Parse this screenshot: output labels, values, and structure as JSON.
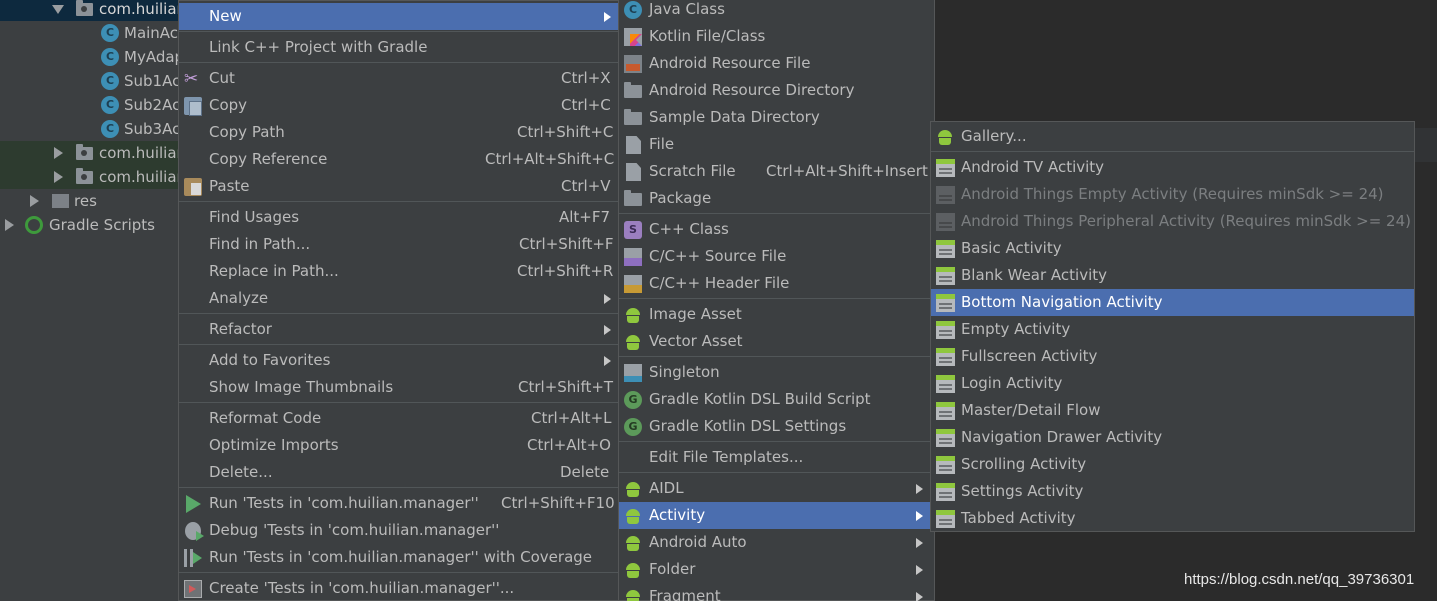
{
  "tree": {
    "items": [
      {
        "label": "com.huilian",
        "icon": "folder-icon",
        "expanded": true
      },
      {
        "label": "MainAc",
        "icon": "class-icon"
      },
      {
        "label": "MyAdap",
        "icon": "class-icon"
      },
      {
        "label": "Sub1Ac",
        "icon": "class-icon"
      },
      {
        "label": "Sub2Ac",
        "icon": "class-icon"
      },
      {
        "label": "Sub3Ac",
        "icon": "class-icon"
      },
      {
        "label": "com.huilian",
        "icon": "folder-icon",
        "expanded": false
      },
      {
        "label": "com.huilian",
        "icon": "folder-icon",
        "expanded": false
      },
      {
        "label": "res",
        "icon": "res-folder-icon",
        "expanded": false
      },
      {
        "label": "Gradle Scripts",
        "icon": "gradle-icon",
        "expanded": false
      }
    ],
    "class_glyph": "C"
  },
  "context_menu": {
    "items": [
      {
        "label": "New",
        "submenu": true
      },
      {
        "label": "Link C++ Project with Gradle"
      },
      {
        "label": "Cut",
        "shortcut": "Ctrl+X",
        "icon": "scissors-icon"
      },
      {
        "label": "Copy",
        "shortcut": "Ctrl+C",
        "icon": "copy-icon"
      },
      {
        "label": "Copy Path",
        "shortcut": "Ctrl+Shift+C"
      },
      {
        "label": "Copy Reference",
        "shortcut": "Ctrl+Alt+Shift+C"
      },
      {
        "label": "Paste",
        "shortcut": "Ctrl+V",
        "icon": "paste-icon"
      },
      {
        "label": "Find Usages",
        "shortcut": "Alt+F7"
      },
      {
        "label": "Find in Path...",
        "shortcut": "Ctrl+Shift+F"
      },
      {
        "label": "Replace in Path...",
        "shortcut": "Ctrl+Shift+R"
      },
      {
        "label": "Analyze",
        "submenu": true
      },
      {
        "label": "Refactor",
        "submenu": true
      },
      {
        "label": "Add to Favorites",
        "submenu": true
      },
      {
        "label": "Show Image Thumbnails",
        "shortcut": "Ctrl+Shift+T"
      },
      {
        "label": "Reformat Code",
        "shortcut": "Ctrl+Alt+L"
      },
      {
        "label": "Optimize Imports",
        "shortcut": "Ctrl+Alt+O"
      },
      {
        "label": "Delete...",
        "shortcut": "Delete"
      },
      {
        "label": "Run 'Tests in 'com.huilian.manager''",
        "shortcut": "Ctrl+Shift+F10",
        "icon": "run-icon"
      },
      {
        "label": "Debug 'Tests in 'com.huilian.manager''",
        "icon": "debug-icon"
      },
      {
        "label": "Run 'Tests in 'com.huilian.manager'' with Coverage",
        "icon": "coverage-icon"
      },
      {
        "label": "Create 'Tests in 'com.huilian.manager''...",
        "icon": "create-test-icon"
      }
    ]
  },
  "new_menu": {
    "items": [
      {
        "label": "Java Class",
        "icon": "java-class-icon",
        "glyph": "C"
      },
      {
        "label": "Kotlin File/Class",
        "icon": "kotlin-file-icon"
      },
      {
        "label": "Android Resource File",
        "icon": "resource-file-icon"
      },
      {
        "label": "Android Resource Directory",
        "icon": "folder-icon"
      },
      {
        "label": "Sample Data Directory",
        "icon": "folder-icon"
      },
      {
        "label": "File",
        "icon": "file-icon"
      },
      {
        "label": "Scratch File",
        "shortcut": "Ctrl+Alt+Shift+Insert",
        "icon": "scratch-file-icon"
      },
      {
        "label": "Package",
        "icon": "package-icon"
      },
      {
        "label": "C++ Class",
        "icon": "cpp-class-icon",
        "glyph": "S"
      },
      {
        "label": "C/C++ Source File",
        "icon": "cpp-source-icon"
      },
      {
        "label": "C/C++ Header File",
        "icon": "cpp-header-icon"
      },
      {
        "label": "Image Asset",
        "icon": "android-icon"
      },
      {
        "label": "Vector Asset",
        "icon": "android-icon"
      },
      {
        "label": "Singleton",
        "icon": "singleton-icon"
      },
      {
        "label": "Gradle Kotlin DSL Build Script",
        "icon": "gradle-kotlin-icon",
        "glyph": "G"
      },
      {
        "label": "Gradle Kotlin DSL Settings",
        "icon": "gradle-kotlin-icon",
        "glyph": "G"
      },
      {
        "label": "Edit File Templates..."
      },
      {
        "label": "AIDL",
        "icon": "android-icon",
        "submenu": true
      },
      {
        "label": "Activity",
        "icon": "android-icon",
        "submenu": true
      },
      {
        "label": "Android Auto",
        "icon": "android-icon",
        "submenu": true
      },
      {
        "label": "Folder",
        "icon": "android-icon",
        "submenu": true
      },
      {
        "label": "Fragment",
        "icon": "android-icon",
        "submenu": true
      }
    ]
  },
  "activity_menu": {
    "items": [
      {
        "label": "Gallery...",
        "icon": "android-icon"
      },
      {
        "label": "Android TV Activity",
        "icon": "activity-template-icon"
      },
      {
        "label": "Android Things Empty Activity (Requires minSdk >= 24)",
        "icon": "activity-template-icon",
        "disabled": true
      },
      {
        "label": "Android Things Peripheral Activity (Requires minSdk >= 24)",
        "icon": "activity-template-icon",
        "disabled": true
      },
      {
        "label": "Basic Activity",
        "icon": "activity-template-icon"
      },
      {
        "label": "Blank Wear Activity",
        "icon": "activity-template-icon"
      },
      {
        "label": "Bottom Navigation Activity",
        "icon": "activity-template-icon",
        "selected": true
      },
      {
        "label": "Empty Activity",
        "icon": "activity-template-icon"
      },
      {
        "label": "Fullscreen Activity",
        "icon": "activity-template-icon"
      },
      {
        "label": "Login Activity",
        "icon": "activity-template-icon"
      },
      {
        "label": "Master/Detail Flow",
        "icon": "activity-template-icon"
      },
      {
        "label": "Navigation Drawer Activity",
        "icon": "activity-template-icon"
      },
      {
        "label": "Scrolling Activity",
        "icon": "activity-template-icon"
      },
      {
        "label": "Settings Activity",
        "icon": "activity-template-icon"
      },
      {
        "label": "Tabbed Activity",
        "icon": "activity-template-icon"
      }
    ]
  },
  "watermark": "https://blog.csdn.net/qq_39736301",
  "colors": {
    "menu_bg": "#3c3f41",
    "selection": "#4b6eaf",
    "text": "#bbbbbb",
    "disabled_text": "#7b7e80",
    "android_green": "#8fc73e"
  }
}
